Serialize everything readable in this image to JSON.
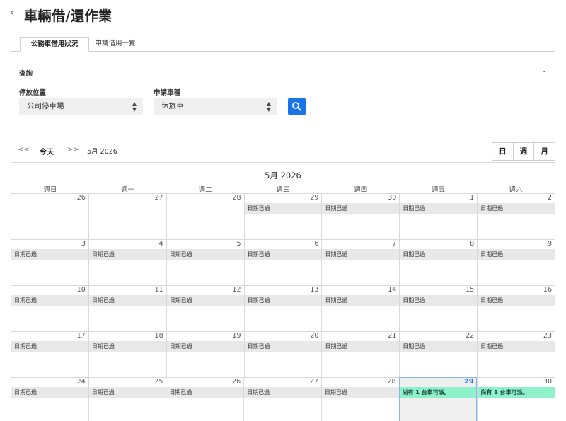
{
  "header": {
    "back_icon": "‹",
    "title": "車輛借/還作業"
  },
  "tabs": [
    {
      "label": "公務車借用狀況",
      "active": true
    },
    {
      "label": "申請借用一覽",
      "active": false
    }
  ],
  "query": {
    "title": "查詢",
    "collapse_icon": "⌄",
    "location_label": "停放位置",
    "location_value": "公司停車場",
    "vehicle_label": "申請車種",
    "vehicle_value": "休旅車",
    "search_icon": "search-icon"
  },
  "calendar_nav": {
    "prev": "<<",
    "today": "今天",
    "next": ">>",
    "month": "5月 2026",
    "views": [
      "日",
      "週",
      "月"
    ]
  },
  "calendar": {
    "title": "5月 2026",
    "weekdays": [
      "週日",
      "週一",
      "週二",
      "週三",
      "週四",
      "週五",
      "週六"
    ],
    "weeks": [
      [
        {
          "day": "26",
          "event": ""
        },
        {
          "day": "27",
          "event": ""
        },
        {
          "day": "28",
          "event": ""
        },
        {
          "day": "29",
          "event": "日期已過"
        },
        {
          "day": "30",
          "event": "日期已過"
        },
        {
          "day": "1",
          "event": "日期已過"
        },
        {
          "day": "2",
          "event": "日期已過"
        }
      ],
      [
        {
          "day": "3",
          "event": "日期已過"
        },
        {
          "day": "4",
          "event": "日期已過"
        },
        {
          "day": "5",
          "event": "日期已過"
        },
        {
          "day": "6",
          "event": "日期已過"
        },
        {
          "day": "7",
          "event": "日期已過"
        },
        {
          "day": "8",
          "event": "日期已過"
        },
        {
          "day": "9",
          "event": "日期已過"
        }
      ],
      [
        {
          "day": "10",
          "event": "日期已過"
        },
        {
          "day": "11",
          "event": "日期已過"
        },
        {
          "day": "12",
          "event": "日期已過"
        },
        {
          "day": "13",
          "event": "日期已過"
        },
        {
          "day": "14",
          "event": "日期已過"
        },
        {
          "day": "15",
          "event": "日期已過"
        },
        {
          "day": "16",
          "event": "日期已過"
        }
      ],
      [
        {
          "day": "17",
          "event": "日期已過"
        },
        {
          "day": "18",
          "event": "日期已過"
        },
        {
          "day": "19",
          "event": "日期已過"
        },
        {
          "day": "20",
          "event": "日期已過"
        },
        {
          "day": "21",
          "event": "日期已過"
        },
        {
          "day": "22",
          "event": "日期已過"
        },
        {
          "day": "23",
          "event": "日期已過"
        }
      ],
      [
        {
          "day": "24",
          "event": "日期已過"
        },
        {
          "day": "25",
          "event": "日期已過"
        },
        {
          "day": "26",
          "event": "日期已過"
        },
        {
          "day": "27",
          "event": "日期已過"
        },
        {
          "day": "28",
          "event": "日期已過"
        },
        {
          "day": "29",
          "event": "尚有 1 台車可派。",
          "available": true,
          "today": true
        },
        {
          "day": "30",
          "event": "尚有 1 台車可派。",
          "available": true
        }
      ]
    ]
  },
  "colors": {
    "accent": "#1a73e8",
    "available": "#8ff0cc",
    "past": "#e8e8e8"
  }
}
